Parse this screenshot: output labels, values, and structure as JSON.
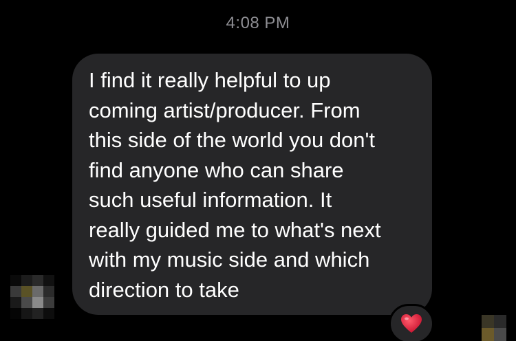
{
  "timestamp": "4:08 PM",
  "message": {
    "text": "I find it really helpful to up\ncoming artist/producer.  From\nthis side of the world you don't\nfind anyone who can share\nsuch useful information. It\nreally guided me to what's next\nwith my music side and which\ndirection to take"
  },
  "reaction": {
    "icon": "heart-icon",
    "color": "#e0263a"
  },
  "colors": {
    "background": "#000000",
    "bubble": "#262628",
    "timestamp": "#8e8e93",
    "text": "#ffffff"
  }
}
